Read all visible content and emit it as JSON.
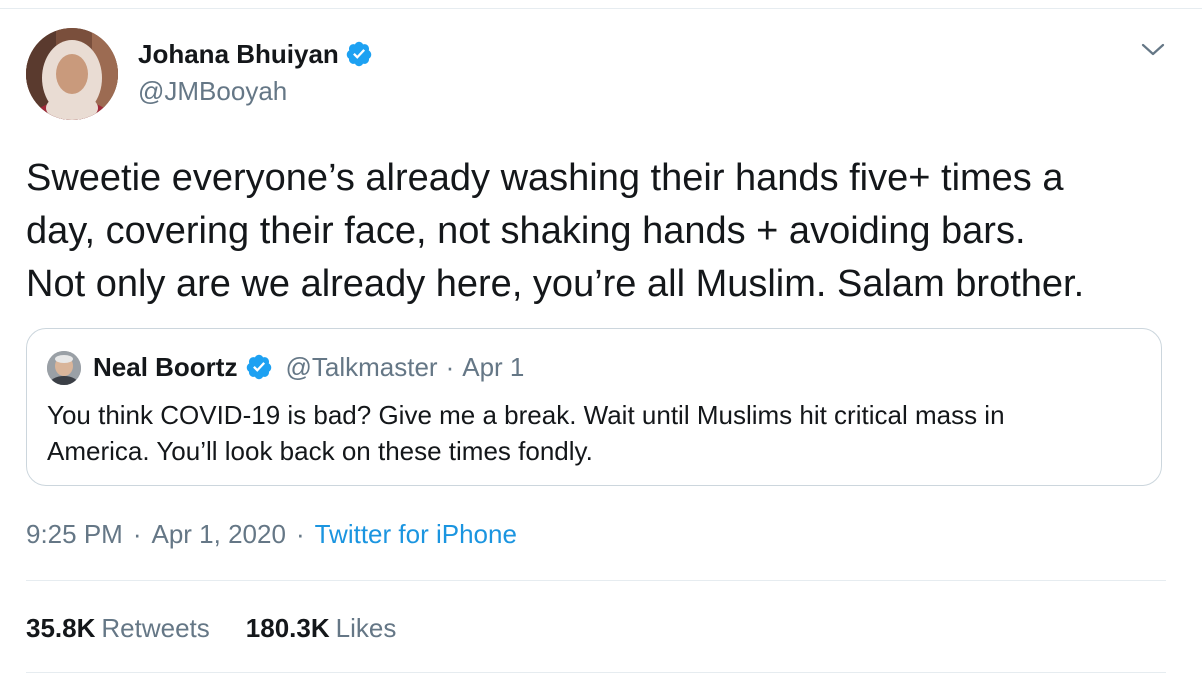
{
  "tweet": {
    "author": {
      "name": "Johana Bhuiyan",
      "handle": "@JMBooyah",
      "verified": true,
      "avatar_icon": "profile-photo"
    },
    "text": "Sweetie everyone’s already washing their hands five+ times a\nday, covering their face, not shaking hands + avoiding bars.\nNot only are we already here, you’re all Muslim. Salam brother.",
    "more_icon": "chevron-down-icon",
    "quoted": {
      "name": "Neal Boortz",
      "handle": "@Talkmaster",
      "separator": "·",
      "date": "Apr 1",
      "verified": true,
      "text": "You think COVID-19 is bad? Give me a break.  Wait until Muslims hit critical mass in\nAmerica. You’ll look back on these times fondly."
    },
    "meta": {
      "time": "9:25 PM",
      "separator": "·",
      "date": "Apr 1, 2020",
      "source": "Twitter for iPhone"
    },
    "stats": {
      "retweets_count": "35.8K",
      "retweets_label": "Retweets",
      "likes_count": "180.3K",
      "likes_label": "Likes"
    }
  },
  "colors": {
    "text_primary": "#14171a",
    "text_secondary": "#657786",
    "link": "#1b95e0",
    "verified_badge": "#1da1f2",
    "border": "#ccd6dd",
    "divider": "#e6ecf0"
  }
}
